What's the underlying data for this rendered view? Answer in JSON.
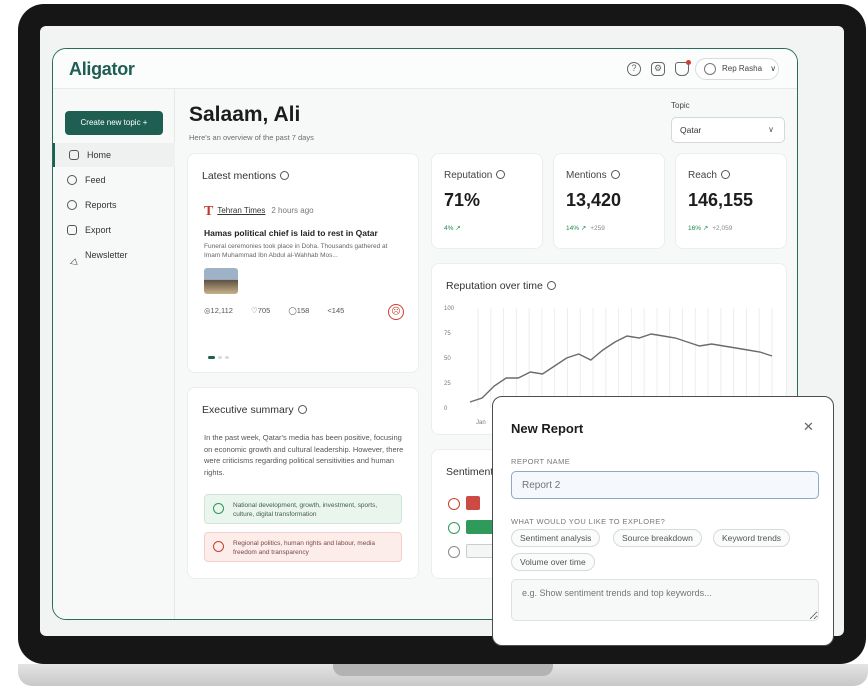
{
  "app": {
    "logo": "Aligator",
    "user_name": "Rep Rasha",
    "user_chevron": "∨"
  },
  "sidebar": {
    "create_button": "Create new topic +",
    "items": [
      {
        "label": "Home",
        "icon": "home-icon"
      },
      {
        "label": "Feed",
        "icon": "feed-icon"
      },
      {
        "label": "Reports",
        "icon": "reports-icon"
      },
      {
        "label": "Export",
        "icon": "export-icon"
      },
      {
        "label": "Newsletter",
        "icon": "send-icon"
      }
    ]
  },
  "header": {
    "greeting": "Salaam, Ali",
    "subtitle": "Here's an overview of the past 7 days",
    "topic_label": "Topic",
    "topic_value": "Qatar"
  },
  "mentions": {
    "title": "Latest mentions",
    "source": "Tehran Times",
    "time": "2 hours ago",
    "headline": "Hamas political chief is laid to rest in Qatar",
    "snippet": "Funeral ceremonies took place in Doha. Thousands gathered at Imam Muhammad Ibn Abdul al-Wahhab Mos...",
    "views": "12,112",
    "likes": "705",
    "comments": "158",
    "shares": "145"
  },
  "metrics": [
    {
      "label": "Reputation",
      "value": "71%",
      "delta": "4% ↗",
      "extra": ""
    },
    {
      "label": "Mentions",
      "value": "13,420",
      "delta": "14% ↗",
      "extra": "+259"
    },
    {
      "label": "Reach",
      "value": "146,155",
      "delta": "16% ↗",
      "extra": "+2,059"
    }
  ],
  "reputation_chart": {
    "title": "Reputation over time",
    "y_ticks": [
      "100",
      "75",
      "50",
      "25",
      "0"
    ],
    "x_first_tick": "Jan",
    "line_color": "#6b6b6b"
  },
  "chart_data": {
    "type": "line",
    "title": "Reputation over time",
    "ylim": [
      0,
      100
    ],
    "series": [
      {
        "values": [
          6,
          10,
          22,
          30,
          30,
          36,
          34,
          42,
          50,
          54,
          48,
          58,
          66,
          72,
          70,
          74,
          72,
          70,
          66,
          62,
          64,
          62,
          60,
          58,
          56,
          52
        ]
      }
    ]
  },
  "summary": {
    "title": "Executive summary",
    "text": "In the past week, Qatar's media has been positive, focusing on economic growth and cultural leadership. However, there were criticisms regarding political sensitivities and human rights.",
    "positive": "National development, growth, investment, sports, culture, digital transformation",
    "negative": "Regional politics, human rights and labour, media freedom and transparency"
  },
  "sentiment": {
    "title": "Sentiment",
    "negative_color": "#cc4a43",
    "positive_color": "#2f9a5a"
  },
  "modal": {
    "title": "New Report",
    "close": "✕",
    "name_label": "REPORT NAME",
    "name_placeholder": "Report 2",
    "explore_label": "WHAT WOULD YOU LIKE TO EXPLORE?",
    "chips": [
      "Sentiment analysis",
      "Source breakdown",
      "Keyword trends",
      "Volume over time"
    ],
    "explore_placeholder": "e.g. Show sentiment trends and top keywords..."
  }
}
